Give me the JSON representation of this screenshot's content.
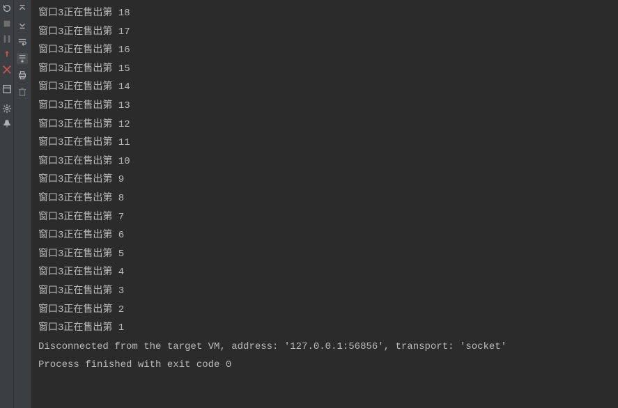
{
  "console": {
    "lines": [
      "窗口3正在售出第 18",
      "窗口3正在售出第 17",
      "窗口3正在售出第 16",
      "窗口3正在售出第 15",
      "窗口3正在售出第 14",
      "窗口3正在售出第 13",
      "窗口3正在售出第 12",
      "窗口3正在售出第 11",
      "窗口3正在售出第 10",
      "窗口3正在售出第 9",
      "窗口3正在售出第 8",
      "窗口3正在售出第 7",
      "窗口3正在售出第 6",
      "窗口3正在售出第 5",
      "窗口3正在售出第 4",
      "窗口3正在售出第 3",
      "窗口3正在售出第 2",
      "窗口3正在售出第 1",
      "Disconnected from the target VM, address: '127.0.0.1:56856', transport: 'socket'",
      "",
      "Process finished with exit code 0"
    ]
  }
}
